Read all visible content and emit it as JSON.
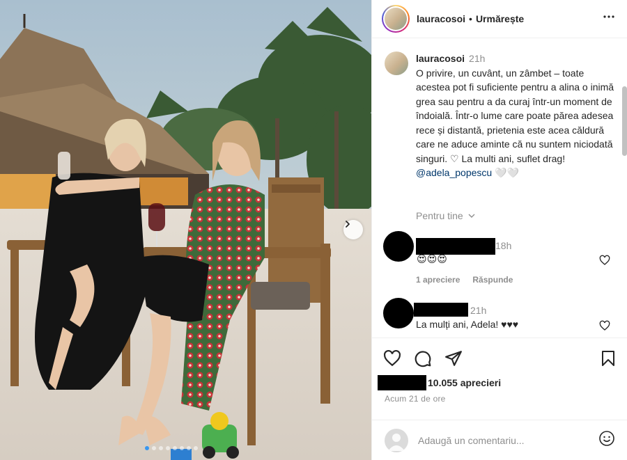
{
  "post": {
    "username": "lauracosoi",
    "follow_label": "Urmărește",
    "more_label": "•••",
    "caption_time": "21h",
    "caption_text": "O privire, un cuvânt, un zâmbet – toate acestea pot fi suficiente pentru a alina o inimă grea sau pentru a da curaj într-un moment de îndoială. Într-o lume care poate părea adesea rece și distantă, prietenia este acea căldură care ne aduce aminte că nu suntem niciodată singuri. ♡ La multi ani, suflet drag!",
    "mention": "@adela_popescu",
    "mention_suffix": " 🤍🤍",
    "for_you_label": "Pentru tine"
  },
  "comments": [
    {
      "time": "18h",
      "text": "😍😍😍",
      "likes_label": "1 apreciere",
      "reply_label": "Răspunde"
    },
    {
      "time": "21h",
      "text": "La mulți ani, Adela! ♥♥♥"
    }
  ],
  "footer": {
    "likes_count": "10.055 aprecieri",
    "posted_ago": "Acum 21 de ore",
    "comment_placeholder": "Adaugă un comentariu..."
  },
  "carousel": {
    "slide_count": 8,
    "active_index": 0
  },
  "colors": {
    "accent": "#3897f0",
    "muted": "#8e8e8e",
    "mention": "#00376b"
  },
  "icons": [
    "more-icon",
    "chevron-down-icon",
    "heart-icon",
    "comment-icon",
    "share-icon",
    "bookmark-icon",
    "emoji-icon",
    "chevron-right-icon"
  ]
}
